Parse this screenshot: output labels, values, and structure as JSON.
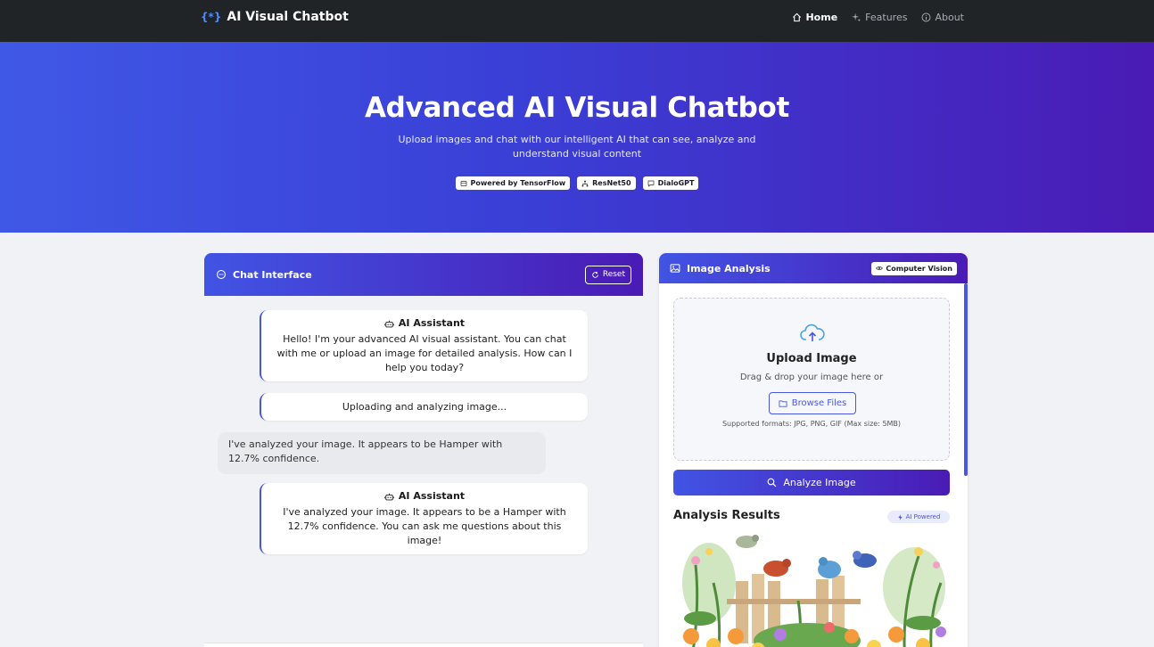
{
  "navbar": {
    "brand_icon": "{*}",
    "brand": "AI Visual Chatbot",
    "links": [
      {
        "label": "Home",
        "icon": "home-icon"
      },
      {
        "label": "Features",
        "icon": "sparkle-icon"
      },
      {
        "label": "About",
        "icon": "info-icon"
      }
    ]
  },
  "hero": {
    "title": "Advanced AI Visual Chatbot",
    "subtitle": "Upload images and chat with our intelligent AI that can see, analyze and understand visual content",
    "badges": [
      {
        "label": "Powered by TensorFlow",
        "icon": "chip-icon"
      },
      {
        "label": "ResNet50",
        "icon": "network-icon"
      },
      {
        "label": "DialoGPT",
        "icon": "chat-icon"
      }
    ]
  },
  "chat": {
    "title": "Chat Interface",
    "reset_label": "Reset",
    "messages": [
      {
        "sender": "AI Assistant",
        "text": "Hello! I'm your advanced AI visual assistant. You can chat with me or upload an image for detailed analysis. How can I help you today?"
      },
      {
        "text": "Uploading and analyzing image..."
      },
      {
        "text": "I've analyzed your image. It appears to be Hamper with 12.7% confidence."
      },
      {
        "sender": "AI Assistant",
        "text": "I've analyzed your image. It appears to be a Hamper with 12.7% confidence. You can ask me questions about this image!"
      }
    ]
  },
  "image_panel": {
    "title": "Image Analysis",
    "badge": "Computer Vision",
    "upload_title": "Upload Image",
    "upload_hint": "Drag & drop your image here or",
    "browse_label": "Browse Files",
    "formats": "Supported formats: JPG, PNG, GIF (Max size: 5MB)",
    "analyze_label": "Analyze Image",
    "results_title": "Analysis Results",
    "ai_badge": "AI Powered"
  },
  "colors": {
    "navbar": "#212427",
    "accent": "#4a55e0",
    "gradient_start": "#4154e4",
    "gradient_end": "#4a1bb5"
  }
}
